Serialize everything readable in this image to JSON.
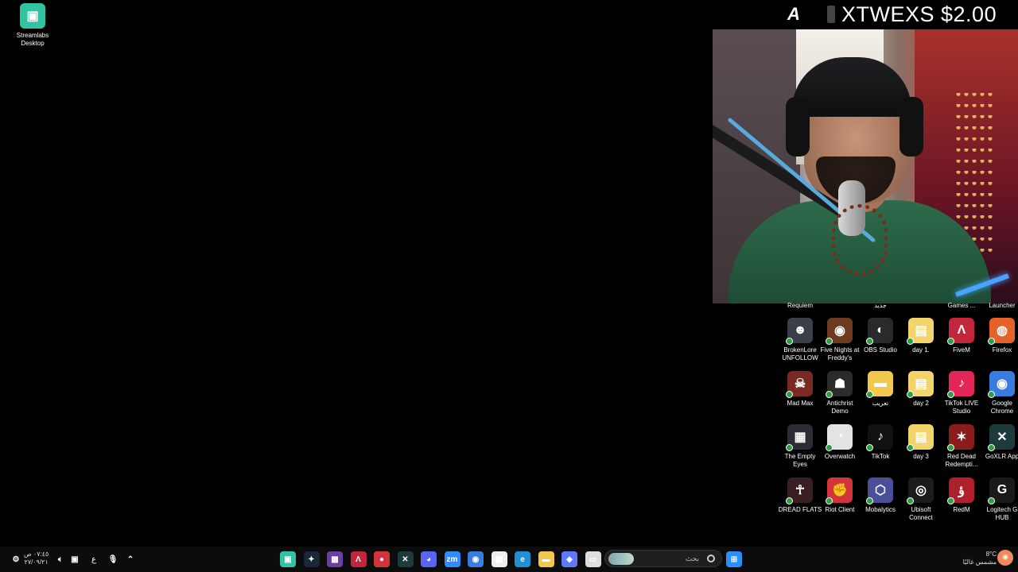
{
  "overlay": {
    "logo_letter": "A",
    "name_amount": "XTWEXS $2.00"
  },
  "desktop_left": [
    {
      "label": "Streamlabs\nDesktop",
      "color": "#31c3a2",
      "glyph": "▣"
    }
  ],
  "row0_labels": [
    "Requiem",
    "جديد",
    "Games ...",
    "Launcher"
  ],
  "desktop_grid": [
    [
      {
        "label": "BrokenLore UNFOLLOW",
        "color": "#3a3f4a",
        "glyph": "☻"
      },
      {
        "label": "Five Nights at Freddy's",
        "color": "#6b3a1f",
        "glyph": "◉"
      },
      {
        "label": "OBS Studio",
        "color": "#2a2a2a",
        "glyph": "◐"
      },
      {
        "label": "day 1.",
        "color": "#f3d46a",
        "glyph": "▤"
      },
      {
        "label": "FiveM",
        "color": "#c1263b",
        "glyph": "Λ"
      },
      {
        "label": "Firefox",
        "color": "#e6622b",
        "glyph": "◍"
      }
    ],
    [
      {
        "label": "Mad Max",
        "color": "#7a2a22",
        "glyph": "☠"
      },
      {
        "label": "Antichrist Demo",
        "color": "#2b2b2b",
        "glyph": "☗"
      },
      {
        "label": "تعريب",
        "color": "#f2c84b",
        "glyph": "▬"
      },
      {
        "label": "day 2",
        "color": "#f3d46a",
        "glyph": "▤"
      },
      {
        "label": "TikTok LIVE Studio",
        "color": "#e3265a",
        "glyph": "♪"
      },
      {
        "label": "Google Chrome",
        "color": "#3a7be0",
        "glyph": "◉"
      }
    ],
    [
      {
        "label": "The Empty Eyes",
        "color": "#2c2c34",
        "glyph": "▦"
      },
      {
        "label": "Overwatch",
        "color": "#e3e3e3",
        "glyph": "◔"
      },
      {
        "label": "TikTok",
        "color": "#111",
        "glyph": "♪"
      },
      {
        "label": "day 3",
        "color": "#f3d46a",
        "glyph": "▤"
      },
      {
        "label": "Red Dead Redempti...",
        "color": "#8a1c1c",
        "glyph": "✶"
      },
      {
        "label": "GoXLR App",
        "color": "#1e3a3a",
        "glyph": "✕"
      }
    ],
    [
      {
        "label": "DREAD FLATS",
        "color": "#3a1e22",
        "glyph": "☥"
      },
      {
        "label": "Riot Client",
        "color": "#d2343c",
        "glyph": "✊"
      },
      {
        "label": "Mobalytics",
        "color": "#4a4f9a",
        "glyph": "⬡"
      },
      {
        "label": "Ubisoft Connect",
        "color": "#1c1c1c",
        "glyph": "◎"
      },
      {
        "label": "RedM",
        "color": "#b0202a",
        "glyph": "ؤ"
      },
      {
        "label": "Logitech G HUB",
        "color": "#1a1a1a",
        "glyph": "G"
      }
    ]
  ],
  "taskbar": {
    "time": "٠٧:٤٥ ص",
    "date": "٢٧/٠٩/٢١",
    "lang": "ع",
    "search_placeholder": "بحث",
    "weather_temp": "8°C",
    "weather_desc": "مشمس غالبًا"
  },
  "taskbar_apps": [
    {
      "name": "streamlabs-taskbar-icon",
      "color": "#31c3a2",
      "glyph": "▣"
    },
    {
      "name": "steam-taskbar-icon",
      "color": "#1b2838",
      "glyph": "✦"
    },
    {
      "name": "game-taskbar-icon",
      "color": "#6b3fa0",
      "glyph": "▩"
    },
    {
      "name": "fivem-taskbar-icon",
      "color": "#c1263b",
      "glyph": "Λ"
    },
    {
      "name": "app-red-taskbar-icon",
      "color": "#d2343c",
      "glyph": "●"
    },
    {
      "name": "goxlr-taskbar-icon",
      "color": "#1e3a3a",
      "glyph": "✕"
    },
    {
      "name": "discord-taskbar-icon",
      "color": "#5865f2",
      "glyph": "◕"
    },
    {
      "name": "zoom-taskbar-icon",
      "color": "#2d8cff",
      "glyph": "zm"
    },
    {
      "name": "chrome-taskbar-icon",
      "color": "#3a7be0",
      "glyph": "◉"
    },
    {
      "name": "store-taskbar-icon",
      "color": "#eee",
      "glyph": "▦"
    },
    {
      "name": "edge-taskbar-icon",
      "color": "#1f8fd6",
      "glyph": "e"
    },
    {
      "name": "explorer-taskbar-icon",
      "color": "#f2c84b",
      "glyph": "▬"
    },
    {
      "name": "copilot-taskbar-icon",
      "color": "#5e7bff",
      "glyph": "◈"
    },
    {
      "name": "window-taskbar-icon",
      "color": "#ddd",
      "glyph": "▭"
    }
  ]
}
